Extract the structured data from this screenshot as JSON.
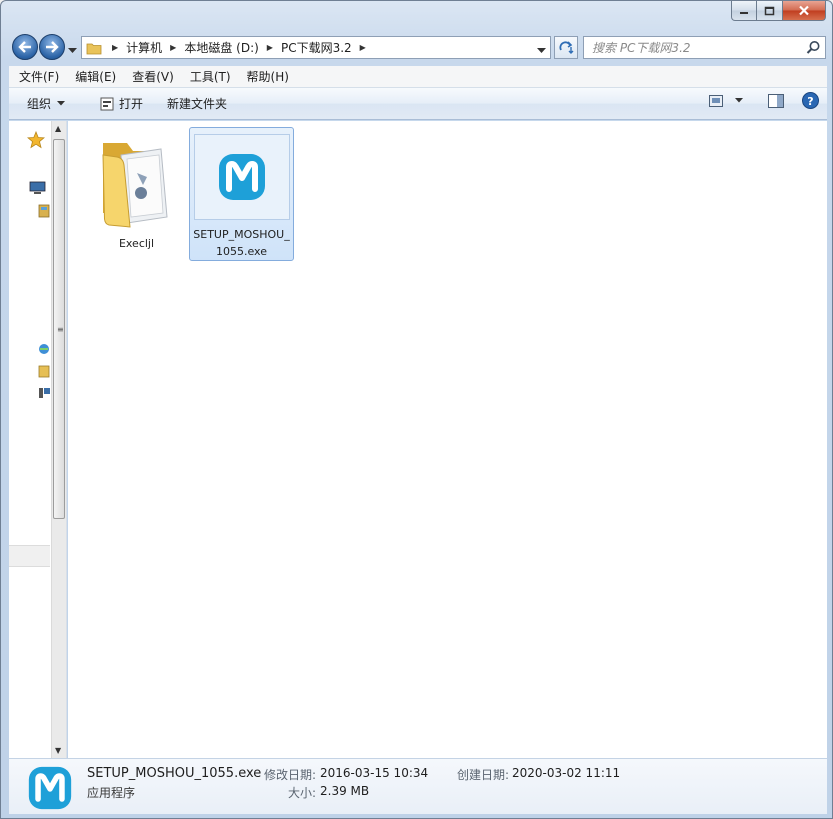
{
  "window": {
    "caption_buttons": {
      "minimize": "minimize",
      "maximize": "maximize",
      "close": "close"
    }
  },
  "address": {
    "breadcrumbs": [
      "计算机",
      "本地磁盘 (D:)",
      "PC下载网3.2"
    ]
  },
  "search": {
    "placeholder": "搜索 PC下载网3.2"
  },
  "menu": {
    "items": [
      "文件(F)",
      "编辑(E)",
      "查看(V)",
      "工具(T)",
      "帮助(H)"
    ]
  },
  "toolbar": {
    "organize_label": "组织",
    "open_label": "打开",
    "new_folder_label": "新建文件夹"
  },
  "files": [
    {
      "name": "Execljl",
      "type": "folder-icon",
      "selected": false
    },
    {
      "name": "SETUP_MOSHOU_1055.exe",
      "type": "app-icon",
      "selected": true
    }
  ],
  "details": {
    "file_name": "SETUP_MOSHOU_1055.exe",
    "file_type": "应用程序",
    "modified_label": "修改日期:",
    "modified_value": "2016-03-15 10:34",
    "created_label": "创建日期:",
    "created_value": "2020-03-02 11:11",
    "size_label": "大小:",
    "size_value": "2.39 MB"
  },
  "colors": {
    "app_icon": "#1ea0d8",
    "selection": "#cfe3f9",
    "folder": "#f3cf6a"
  }
}
